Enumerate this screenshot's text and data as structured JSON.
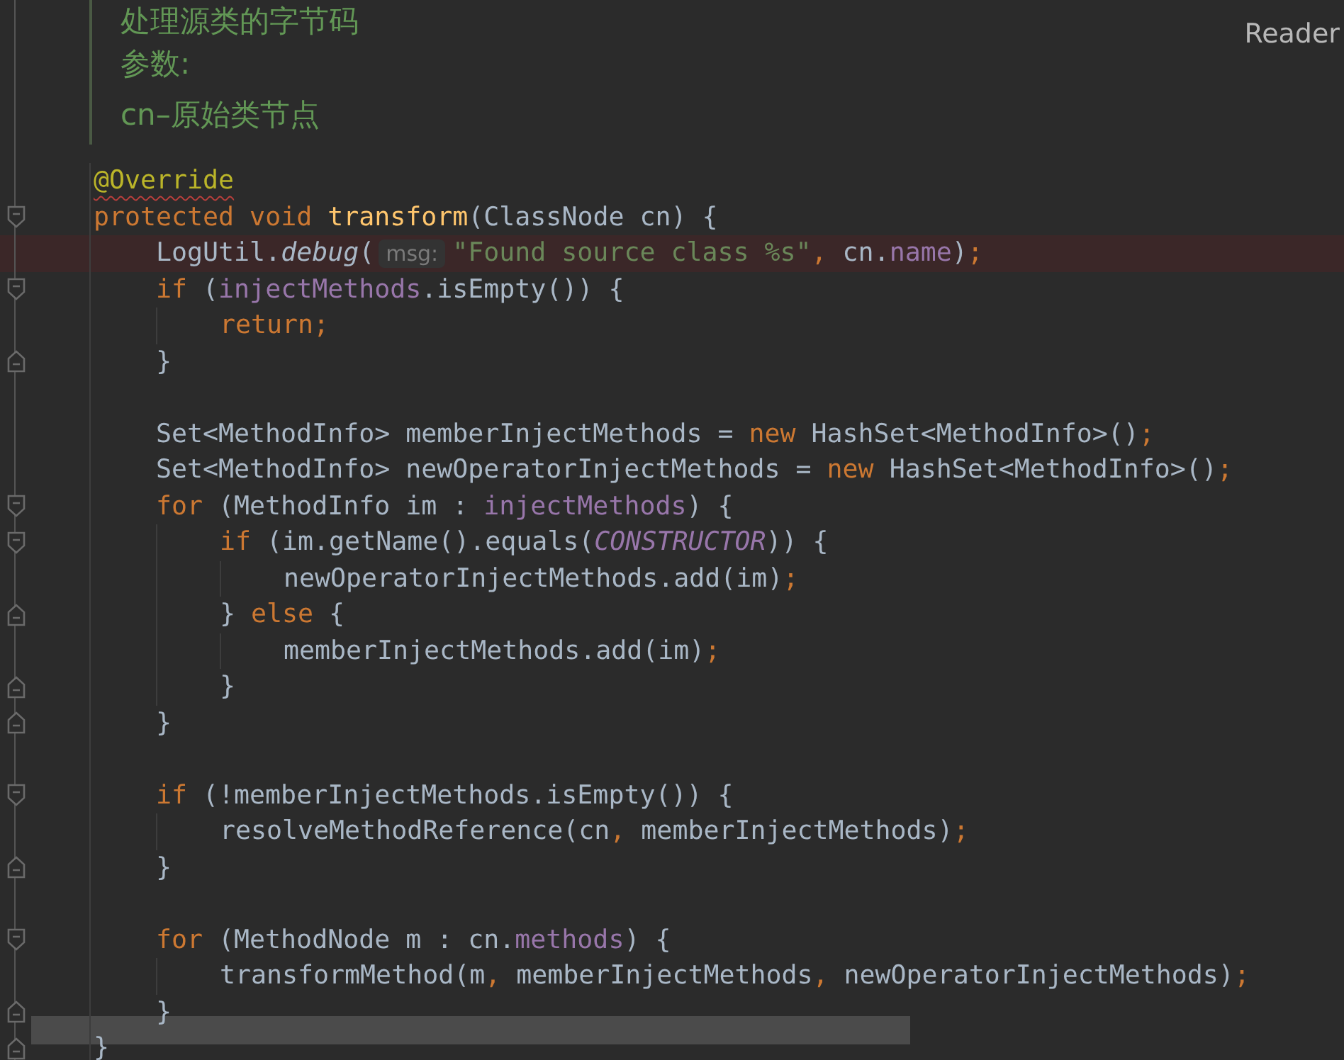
{
  "side_label": "Reader",
  "doc_comment": {
    "lines": [
      "处理源类的字节码",
      "参数:",
      "cn–原始类节点"
    ]
  },
  "editor": {
    "lines": [
      {
        "kind": "code",
        "fold_start": false,
        "fold_end": false,
        "highlighted": false,
        "tokens": [
          {
            "kind": "annotation",
            "text": "@Override",
            "underlined": true
          }
        ]
      },
      {
        "kind": "code",
        "fold_start": true,
        "fold_end": false,
        "highlighted": false,
        "tokens": [
          {
            "kind": "kw",
            "text": "protected void "
          },
          {
            "kind": "decl",
            "text": "transform"
          },
          {
            "kind": "plain",
            "text": "(ClassNode cn) {"
          }
        ],
        "children": [
          {
            "kind": "code",
            "fold_start": false,
            "fold_end": false,
            "highlighted": true,
            "tokens": [
              {
                "kind": "plain",
                "text": "LogUtil."
              },
              {
                "kind": "italic",
                "text": "debug"
              },
              {
                "kind": "plain",
                "text": "("
              },
              {
                "kind": "hint",
                "text": "msg:"
              },
              {
                "kind": "str",
                "text": "\"Found source class %s\""
              },
              {
                "kind": "punct",
                "text": ","
              },
              {
                "kind": "plain",
                "text": " cn."
              },
              {
                "kind": "field",
                "text": "name"
              },
              {
                "kind": "plain",
                "text": ")"
              },
              {
                "kind": "punct",
                "text": ";"
              }
            ]
          },
          {
            "kind": "code",
            "fold_start": true,
            "fold_end": false,
            "highlighted": false,
            "tokens": [
              {
                "kind": "kw",
                "text": "if "
              },
              {
                "kind": "plain",
                "text": "("
              },
              {
                "kind": "field",
                "text": "injectMethods"
              },
              {
                "kind": "plain",
                "text": ".isEmpty()) {"
              }
            ],
            "children": [
              {
                "kind": "code",
                "fold_start": false,
                "fold_end": false,
                "highlighted": false,
                "tokens": [
                  {
                    "kind": "kw",
                    "text": "return"
                  },
                  {
                    "kind": "punct",
                    "text": ";"
                  }
                ]
              }
            ]
          },
          {
            "kind": "code",
            "fold_start": false,
            "fold_end": true,
            "highlighted": false,
            "tokens": [
              {
                "kind": "plain",
                "text": "}"
              }
            ]
          },
          {
            "kind": "blank"
          },
          {
            "kind": "code",
            "fold_start": false,
            "fold_end": false,
            "highlighted": false,
            "tokens": [
              {
                "kind": "plain",
                "text": "Set<MethodInfo> memberInjectMethods = "
              },
              {
                "kind": "kw",
                "text": "new"
              },
              {
                "kind": "plain",
                "text": " HashSet<MethodInfo>()"
              },
              {
                "kind": "punct",
                "text": ";"
              }
            ]
          },
          {
            "kind": "code",
            "fold_start": false,
            "fold_end": false,
            "highlighted": false,
            "tokens": [
              {
                "kind": "plain",
                "text": "Set<MethodInfo> newOperatorInjectMethods = "
              },
              {
                "kind": "kw",
                "text": "new"
              },
              {
                "kind": "plain",
                "text": " HashSet<MethodInfo>()"
              },
              {
                "kind": "punct",
                "text": ";"
              }
            ]
          },
          {
            "kind": "code",
            "fold_start": true,
            "fold_end": false,
            "highlighted": false,
            "tokens": [
              {
                "kind": "kw",
                "text": "for "
              },
              {
                "kind": "plain",
                "text": "(MethodInfo im : "
              },
              {
                "kind": "field",
                "text": "injectMethods"
              },
              {
                "kind": "plain",
                "text": ") {"
              }
            ],
            "children": [
              {
                "kind": "code",
                "fold_start": true,
                "fold_end": false,
                "highlighted": false,
                "tokens": [
                  {
                    "kind": "kw",
                    "text": "if "
                  },
                  {
                    "kind": "plain",
                    "text": "(im.getName().equals("
                  },
                  {
                    "kind": "static",
                    "text": "CONSTRUCTOR"
                  },
                  {
                    "kind": "plain",
                    "text": ")) {"
                  }
                ],
                "children": [
                  {
                    "kind": "code",
                    "fold_start": false,
                    "fold_end": false,
                    "highlighted": false,
                    "tokens": [
                      {
                        "kind": "plain",
                        "text": "newOperatorInjectMethods.add(im)"
                      },
                      {
                        "kind": "punct",
                        "text": ";"
                      }
                    ]
                  }
                ]
              },
              {
                "kind": "code",
                "fold_start": false,
                "fold_end": true,
                "highlighted": false,
                "tokens": [
                  {
                    "kind": "plain",
                    "text": "} "
                  },
                  {
                    "kind": "kw",
                    "text": "else"
                  },
                  {
                    "kind": "plain",
                    "text": " {"
                  }
                ],
                "children": [
                  {
                    "kind": "code",
                    "fold_start": false,
                    "fold_end": false,
                    "highlighted": false,
                    "tokens": [
                      {
                        "kind": "plain",
                        "text": "memberInjectMethods.add(im)"
                      },
                      {
                        "kind": "punct",
                        "text": ";"
                      }
                    ]
                  }
                ]
              },
              {
                "kind": "code",
                "fold_start": false,
                "fold_end": true,
                "highlighted": false,
                "tokens": [
                  {
                    "kind": "plain",
                    "text": "}"
                  }
                ]
              }
            ]
          },
          {
            "kind": "code",
            "fold_start": false,
            "fold_end": true,
            "highlighted": false,
            "tokens": [
              {
                "kind": "plain",
                "text": "}"
              }
            ]
          },
          {
            "kind": "blank"
          },
          {
            "kind": "code",
            "fold_start": true,
            "fold_end": false,
            "highlighted": false,
            "tokens": [
              {
                "kind": "kw",
                "text": "if "
              },
              {
                "kind": "plain",
                "text": "(!memberInjectMethods.isEmpty()) {"
              }
            ],
            "children": [
              {
                "kind": "code",
                "fold_start": false,
                "fold_end": false,
                "highlighted": false,
                "tokens": [
                  {
                    "kind": "plain",
                    "text": "resolveMethodReference(cn"
                  },
                  {
                    "kind": "punct",
                    "text": ","
                  },
                  {
                    "kind": "plain",
                    "text": " memberInjectMethods)"
                  },
                  {
                    "kind": "punct",
                    "text": ";"
                  }
                ]
              }
            ]
          },
          {
            "kind": "code",
            "fold_start": false,
            "fold_end": true,
            "highlighted": false,
            "tokens": [
              {
                "kind": "plain",
                "text": "}"
              }
            ]
          },
          {
            "kind": "blank"
          },
          {
            "kind": "code",
            "fold_start": true,
            "fold_end": false,
            "highlighted": false,
            "tokens": [
              {
                "kind": "kw",
                "text": "for "
              },
              {
                "kind": "plain",
                "text": "(MethodNode m : cn."
              },
              {
                "kind": "field",
                "text": "methods"
              },
              {
                "kind": "plain",
                "text": ") {"
              }
            ],
            "children": [
              {
                "kind": "code",
                "fold_start": false,
                "fold_end": false,
                "highlighted": false,
                "tokens": [
                  {
                    "kind": "plain",
                    "text": "transformMethod(m"
                  },
                  {
                    "kind": "punct",
                    "text": ","
                  },
                  {
                    "kind": "plain",
                    "text": " memberInjectMethods"
                  },
                  {
                    "kind": "punct",
                    "text": ","
                  },
                  {
                    "kind": "plain",
                    "text": " newOperatorInjectMethods)"
                  },
                  {
                    "kind": "punct",
                    "text": ";"
                  }
                ]
              }
            ]
          },
          {
            "kind": "code",
            "fold_start": false,
            "fold_end": true,
            "highlighted": false,
            "tokens": [
              {
                "kind": "plain",
                "text": "}"
              }
            ]
          }
        ]
      },
      {
        "kind": "code",
        "fold_start": false,
        "fold_end": true,
        "highlighted": false,
        "tokens": [
          {
            "kind": "plain",
            "text": "}"
          }
        ]
      }
    ]
  }
}
